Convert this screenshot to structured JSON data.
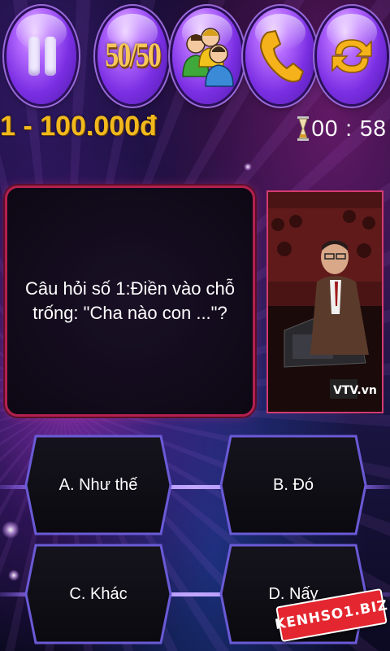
{
  "lifelines": {
    "pause": {
      "label": "pause"
    },
    "fifty_fifty": {
      "label": "50/50"
    },
    "ask_audience": {
      "label": "ask-audience"
    },
    "phone_friend": {
      "label": "phone-a-friend"
    },
    "switch_question": {
      "label": "switch-question"
    }
  },
  "status": {
    "prize": "1 - 100.000đ",
    "timer": "00 : 58"
  },
  "question": {
    "text": "Câu hỏi số 1:Điền vào chỗ trống: \"Cha nào con ...\"?"
  },
  "answers": {
    "a": "A. Như thế",
    "b": "B. Đó",
    "c": "C. Khác",
    "d": "D. Nấy"
  },
  "badge": {
    "text": "KENHSO1.BIZ"
  },
  "host_image": {
    "watermark": "VTV.vn"
  },
  "colors": {
    "lifeline_purple": "#7b2fe3",
    "prize_gold": "#f2b91e",
    "question_border": "#b3204f",
    "answer_border": "#6a5ad6",
    "badge_red": "#e3262f"
  },
  "icons": [
    "pause-icon",
    "fifty-fifty-icon",
    "audience-icon",
    "phone-icon",
    "refresh-icon",
    "hourglass-icon"
  ]
}
